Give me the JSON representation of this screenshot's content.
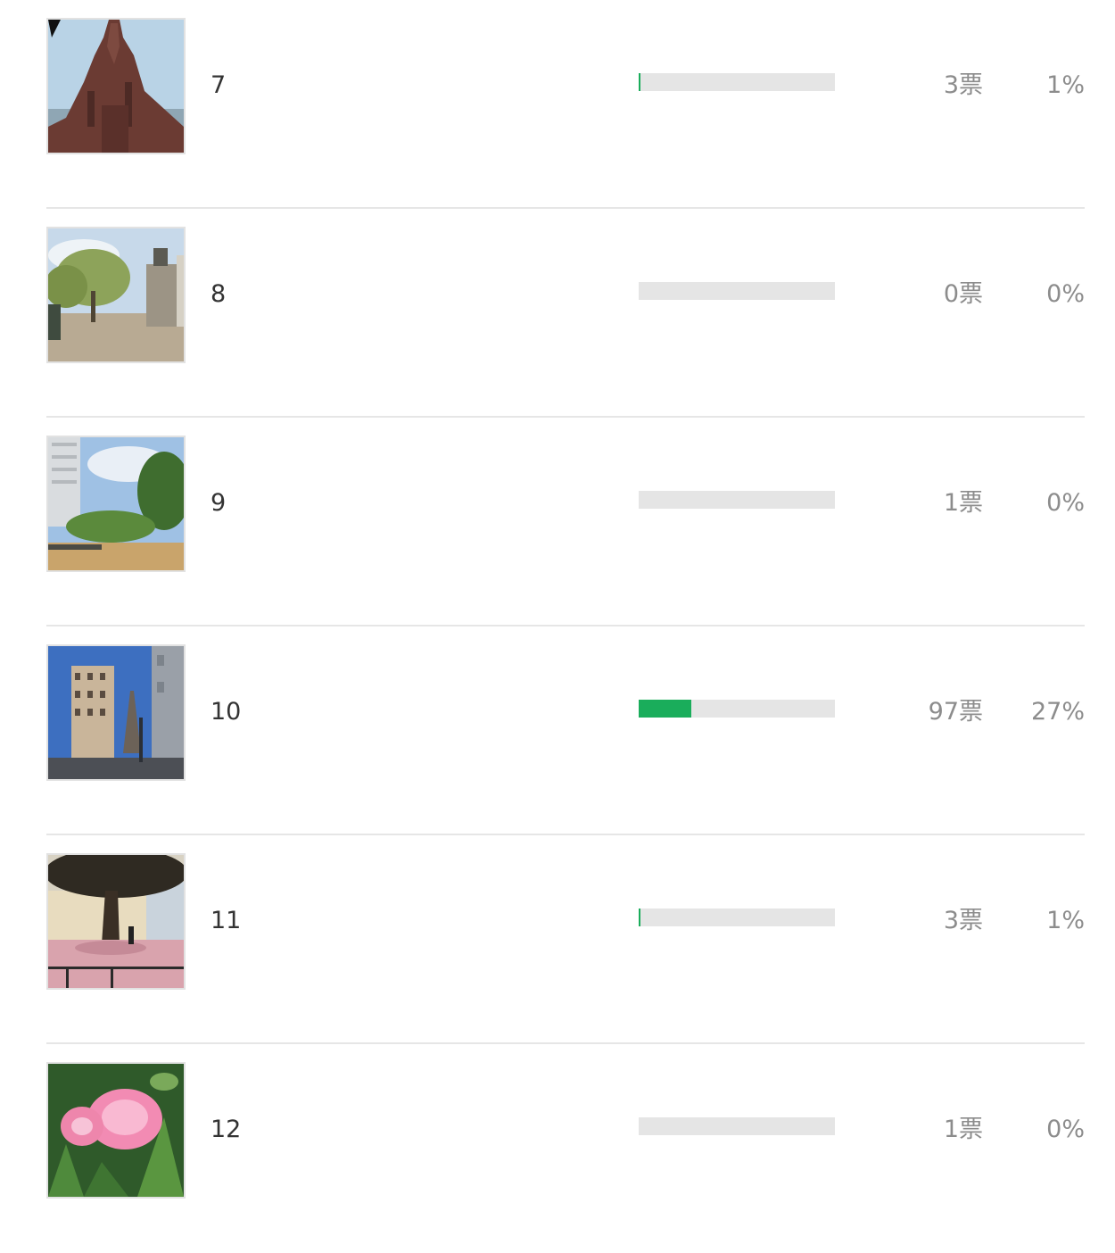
{
  "colors": {
    "bar_fill": "#1aad5b",
    "bar_track": "#e5e5e5",
    "label_text": "#333333",
    "stat_text": "#8c8c8c",
    "divider": "#e6e6e6"
  },
  "options": [
    {
      "label": "7",
      "votes": "3票",
      "percent": "1%",
      "fill_fraction": 0.01,
      "thumbnail": "cathedral-photo"
    },
    {
      "label": "8",
      "votes": "0票",
      "percent": "0%",
      "fill_fraction": 0.0,
      "thumbnail": "square-statue-photo"
    },
    {
      "label": "9",
      "votes": "1票",
      "percent": "0%",
      "fill_fraction": 0.0,
      "thumbnail": "park-photo"
    },
    {
      "label": "10",
      "votes": "97票",
      "percent": "27%",
      "fill_fraction": 0.27,
      "thumbnail": "street-eiffel-photo"
    },
    {
      "label": "11",
      "votes": "3票",
      "percent": "1%",
      "fill_fraction": 0.01,
      "thumbnail": "blossom-tree-photo"
    },
    {
      "label": "12",
      "votes": "1票",
      "percent": "0%",
      "fill_fraction": 0.0,
      "thumbnail": "pink-peony-photo"
    }
  ]
}
